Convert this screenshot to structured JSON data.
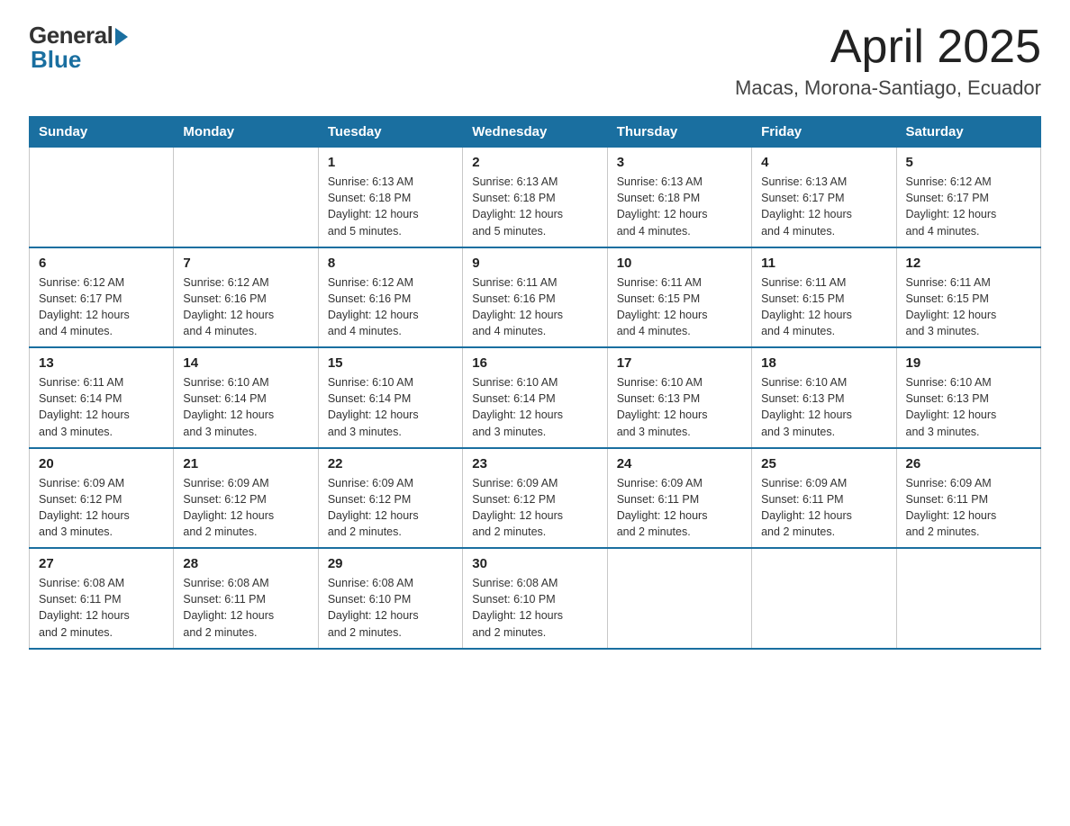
{
  "logo": {
    "general": "General",
    "blue": "Blue"
  },
  "title": "April 2025",
  "subtitle": "Macas, Morona-Santiago, Ecuador",
  "days_of_week": [
    "Sunday",
    "Monday",
    "Tuesday",
    "Wednesday",
    "Thursday",
    "Friday",
    "Saturday"
  ],
  "weeks": [
    [
      {
        "day": "",
        "info": ""
      },
      {
        "day": "",
        "info": ""
      },
      {
        "day": "1",
        "info": "Sunrise: 6:13 AM\nSunset: 6:18 PM\nDaylight: 12 hours\nand 5 minutes."
      },
      {
        "day": "2",
        "info": "Sunrise: 6:13 AM\nSunset: 6:18 PM\nDaylight: 12 hours\nand 5 minutes."
      },
      {
        "day": "3",
        "info": "Sunrise: 6:13 AM\nSunset: 6:18 PM\nDaylight: 12 hours\nand 4 minutes."
      },
      {
        "day": "4",
        "info": "Sunrise: 6:13 AM\nSunset: 6:17 PM\nDaylight: 12 hours\nand 4 minutes."
      },
      {
        "day": "5",
        "info": "Sunrise: 6:12 AM\nSunset: 6:17 PM\nDaylight: 12 hours\nand 4 minutes."
      }
    ],
    [
      {
        "day": "6",
        "info": "Sunrise: 6:12 AM\nSunset: 6:17 PM\nDaylight: 12 hours\nand 4 minutes."
      },
      {
        "day": "7",
        "info": "Sunrise: 6:12 AM\nSunset: 6:16 PM\nDaylight: 12 hours\nand 4 minutes."
      },
      {
        "day": "8",
        "info": "Sunrise: 6:12 AM\nSunset: 6:16 PM\nDaylight: 12 hours\nand 4 minutes."
      },
      {
        "day": "9",
        "info": "Sunrise: 6:11 AM\nSunset: 6:16 PM\nDaylight: 12 hours\nand 4 minutes."
      },
      {
        "day": "10",
        "info": "Sunrise: 6:11 AM\nSunset: 6:15 PM\nDaylight: 12 hours\nand 4 minutes."
      },
      {
        "day": "11",
        "info": "Sunrise: 6:11 AM\nSunset: 6:15 PM\nDaylight: 12 hours\nand 4 minutes."
      },
      {
        "day": "12",
        "info": "Sunrise: 6:11 AM\nSunset: 6:15 PM\nDaylight: 12 hours\nand 3 minutes."
      }
    ],
    [
      {
        "day": "13",
        "info": "Sunrise: 6:11 AM\nSunset: 6:14 PM\nDaylight: 12 hours\nand 3 minutes."
      },
      {
        "day": "14",
        "info": "Sunrise: 6:10 AM\nSunset: 6:14 PM\nDaylight: 12 hours\nand 3 minutes."
      },
      {
        "day": "15",
        "info": "Sunrise: 6:10 AM\nSunset: 6:14 PM\nDaylight: 12 hours\nand 3 minutes."
      },
      {
        "day": "16",
        "info": "Sunrise: 6:10 AM\nSunset: 6:14 PM\nDaylight: 12 hours\nand 3 minutes."
      },
      {
        "day": "17",
        "info": "Sunrise: 6:10 AM\nSunset: 6:13 PM\nDaylight: 12 hours\nand 3 minutes."
      },
      {
        "day": "18",
        "info": "Sunrise: 6:10 AM\nSunset: 6:13 PM\nDaylight: 12 hours\nand 3 minutes."
      },
      {
        "day": "19",
        "info": "Sunrise: 6:10 AM\nSunset: 6:13 PM\nDaylight: 12 hours\nand 3 minutes."
      }
    ],
    [
      {
        "day": "20",
        "info": "Sunrise: 6:09 AM\nSunset: 6:12 PM\nDaylight: 12 hours\nand 3 minutes."
      },
      {
        "day": "21",
        "info": "Sunrise: 6:09 AM\nSunset: 6:12 PM\nDaylight: 12 hours\nand 2 minutes."
      },
      {
        "day": "22",
        "info": "Sunrise: 6:09 AM\nSunset: 6:12 PM\nDaylight: 12 hours\nand 2 minutes."
      },
      {
        "day": "23",
        "info": "Sunrise: 6:09 AM\nSunset: 6:12 PM\nDaylight: 12 hours\nand 2 minutes."
      },
      {
        "day": "24",
        "info": "Sunrise: 6:09 AM\nSunset: 6:11 PM\nDaylight: 12 hours\nand 2 minutes."
      },
      {
        "day": "25",
        "info": "Sunrise: 6:09 AM\nSunset: 6:11 PM\nDaylight: 12 hours\nand 2 minutes."
      },
      {
        "day": "26",
        "info": "Sunrise: 6:09 AM\nSunset: 6:11 PM\nDaylight: 12 hours\nand 2 minutes."
      }
    ],
    [
      {
        "day": "27",
        "info": "Sunrise: 6:08 AM\nSunset: 6:11 PM\nDaylight: 12 hours\nand 2 minutes."
      },
      {
        "day": "28",
        "info": "Sunrise: 6:08 AM\nSunset: 6:11 PM\nDaylight: 12 hours\nand 2 minutes."
      },
      {
        "day": "29",
        "info": "Sunrise: 6:08 AM\nSunset: 6:10 PM\nDaylight: 12 hours\nand 2 minutes."
      },
      {
        "day": "30",
        "info": "Sunrise: 6:08 AM\nSunset: 6:10 PM\nDaylight: 12 hours\nand 2 minutes."
      },
      {
        "day": "",
        "info": ""
      },
      {
        "day": "",
        "info": ""
      },
      {
        "day": "",
        "info": ""
      }
    ]
  ]
}
